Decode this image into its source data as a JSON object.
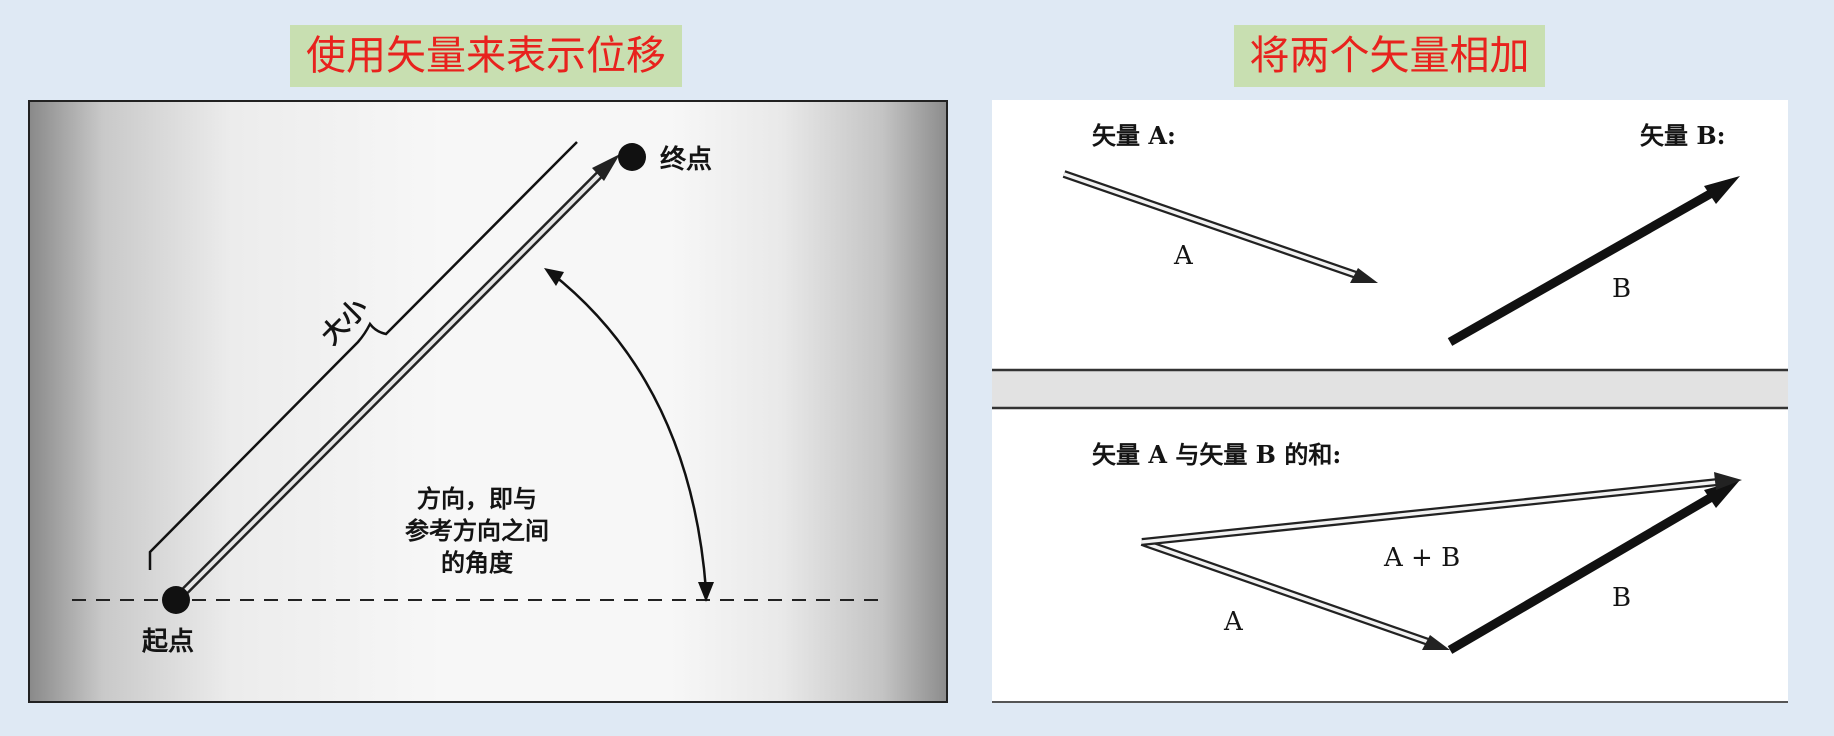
{
  "titles": {
    "left": "使用矢量来表示位移",
    "right": "将两个矢量相加"
  },
  "left_diagram": {
    "end_label": "终点",
    "start_label": "起点",
    "magnitude_label": "大小",
    "direction_label": [
      "方向，即与",
      "参考方向之间",
      "的角度"
    ]
  },
  "right_diagram": {
    "vector_a_heading": "矢量 A:",
    "vector_b_heading": "矢量 B:",
    "vector_a_label": "A",
    "vector_b_label": "B",
    "sum_heading": "矢量 A 与矢量 B 的和:",
    "sum_a_label": "A",
    "sum_b_label": "B",
    "sum_result_label": "A + B"
  },
  "colors": {
    "title_text": "#e8221d",
    "title_bg": "#c8dfb1",
    "page_bg": "#dfe9f4"
  }
}
